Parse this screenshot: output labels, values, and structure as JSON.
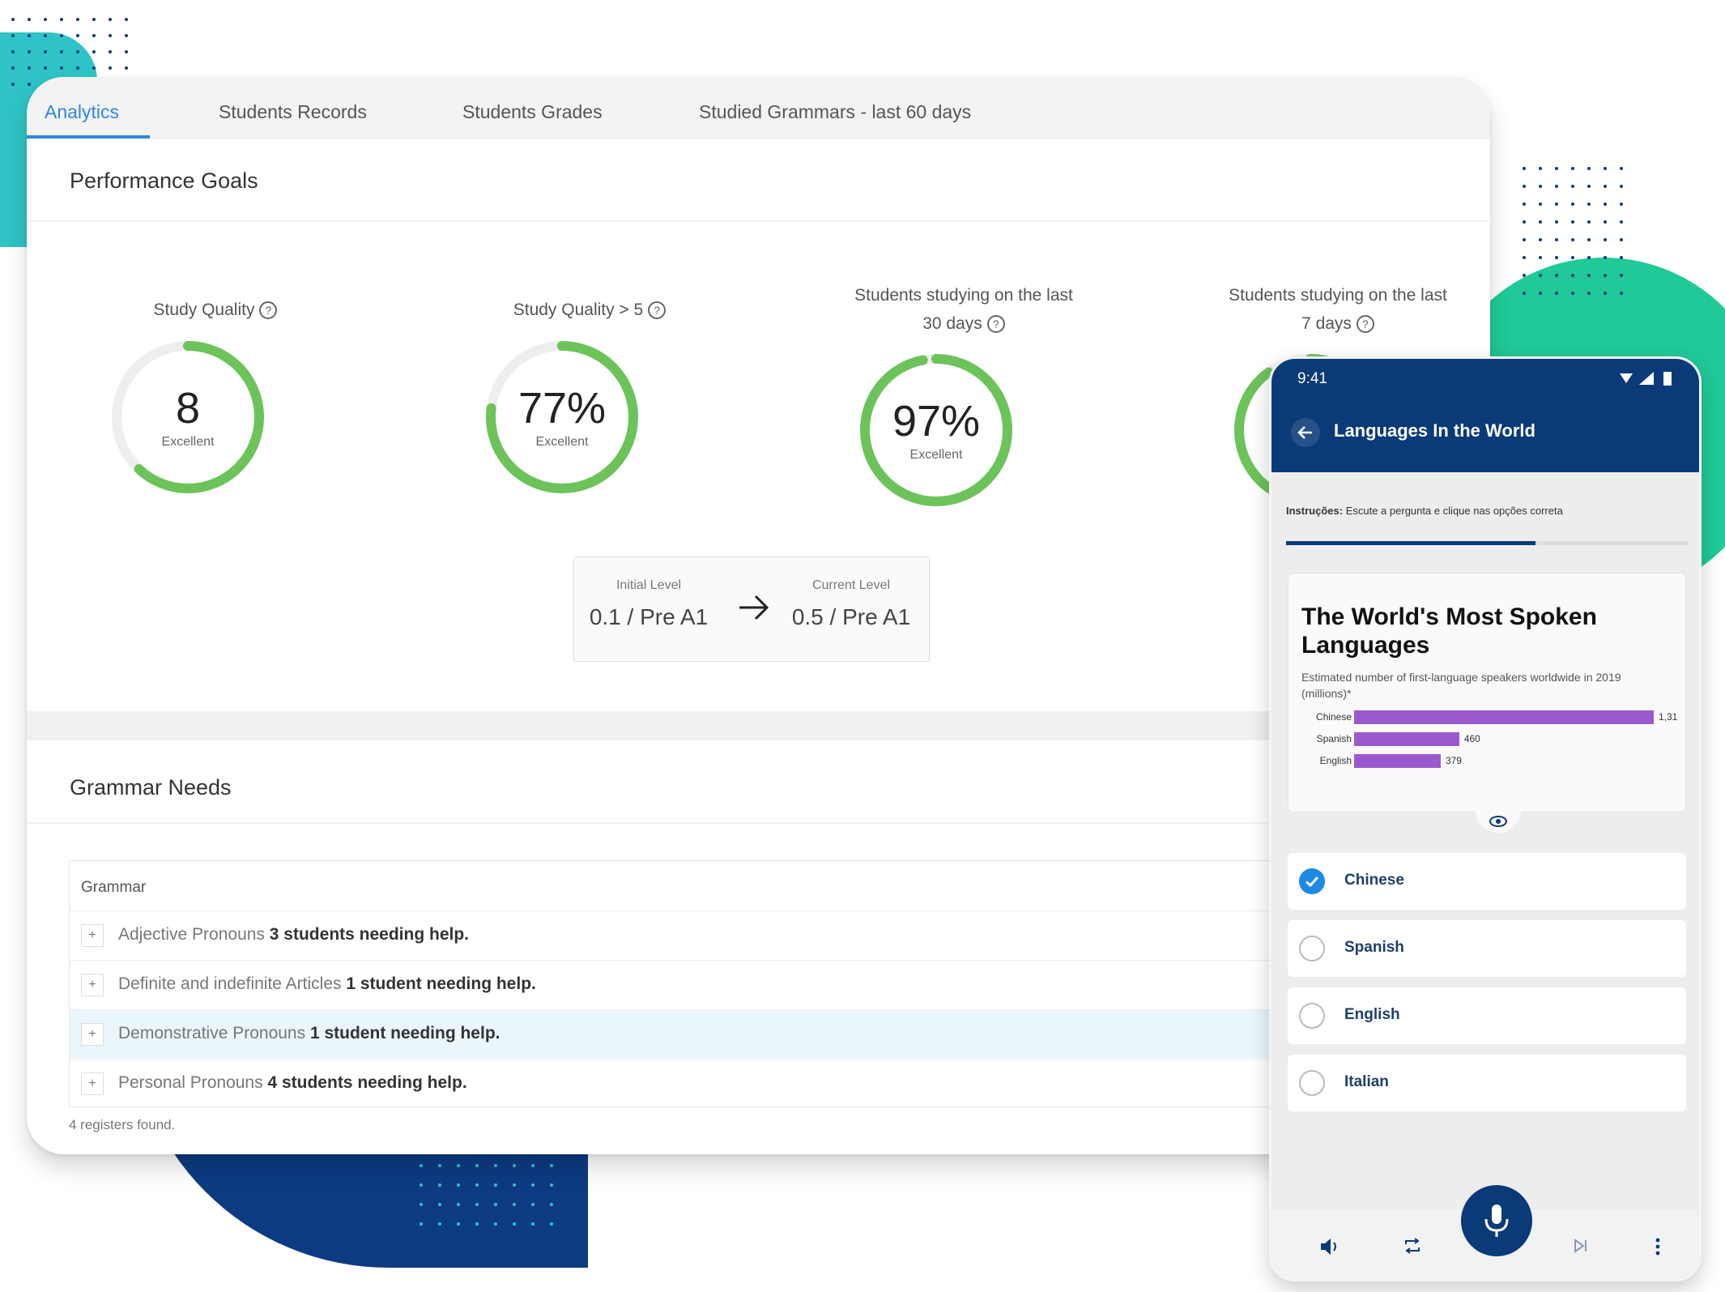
{
  "tabs": [
    {
      "label": "Analytics"
    },
    {
      "label": "Students Records"
    },
    {
      "label": "Students Grades"
    },
    {
      "label": "Studied Grammars - last 60 days"
    }
  ],
  "performance": {
    "title": "Performance Goals",
    "goals": [
      {
        "label_lines": [
          "Study Quality"
        ],
        "value": "8",
        "rating": "Excellent",
        "fill": 0.62
      },
      {
        "label_lines": [
          "Study Quality > 5"
        ],
        "value": "77%",
        "rating": "Excellent",
        "fill": 0.77
      },
      {
        "label_lines": [
          "Students studying on the last",
          "30 days"
        ],
        "value": "97%",
        "rating": "Excellent",
        "fill": 0.97
      },
      {
        "label_lines": [
          "Students studying on the last",
          "7 days"
        ],
        "value": "",
        "rating": "",
        "fill": 0.9
      }
    ],
    "level": {
      "initial_caption": "Initial Level",
      "initial_value": "0.1 / Pre A1",
      "current_caption": "Current Level",
      "current_value": "0.5 / Pre A1"
    }
  },
  "grammar": {
    "title": "Grammar Needs",
    "column": "Grammar",
    "rows": [
      {
        "name": "Adjective Pronouns",
        "count": "3 students needing help."
      },
      {
        "name": "Definite and indefinite Articles",
        "count": "1 student needing help."
      },
      {
        "name": "Demonstrative Pronouns",
        "count": "1 student needing help."
      },
      {
        "name": "Personal Pronouns",
        "count": "4 students needing help."
      }
    ],
    "footer": "4 registers found."
  },
  "phone": {
    "time": "9:41",
    "title": "Languages In the World",
    "instructions_label": "Instruções:",
    "instructions_text": "Escute a pergunta e clique nas opções correta",
    "progress": 0.62,
    "card": {
      "title": "The World's Most Spoken Languages",
      "subtitle": "Estimated number of first-language speakers worldwide in 2019 (millions)*",
      "chart_data": {
        "type": "bar",
        "categories": [
          "Chinese",
          "Spanish",
          "English"
        ],
        "values": [
          1311,
          460,
          379
        ],
        "value_labels": [
          "1,31",
          "460",
          "379"
        ]
      }
    },
    "options": [
      {
        "label": "Chinese",
        "checked": true
      },
      {
        "label": "Spanish",
        "checked": false
      },
      {
        "label": "English",
        "checked": false
      },
      {
        "label": "Italian",
        "checked": false
      }
    ]
  },
  "colors": {
    "accent_blue": "#2e86de",
    "gauge_green": "#6cc35a",
    "gauge_track": "#eeeeee",
    "phone_navy": "#0a3a78",
    "bar_purple": "#9b59d0",
    "teal": "#2ec4c6",
    "green_blob": "#20c997",
    "navy_blob": "#0d3b82"
  }
}
